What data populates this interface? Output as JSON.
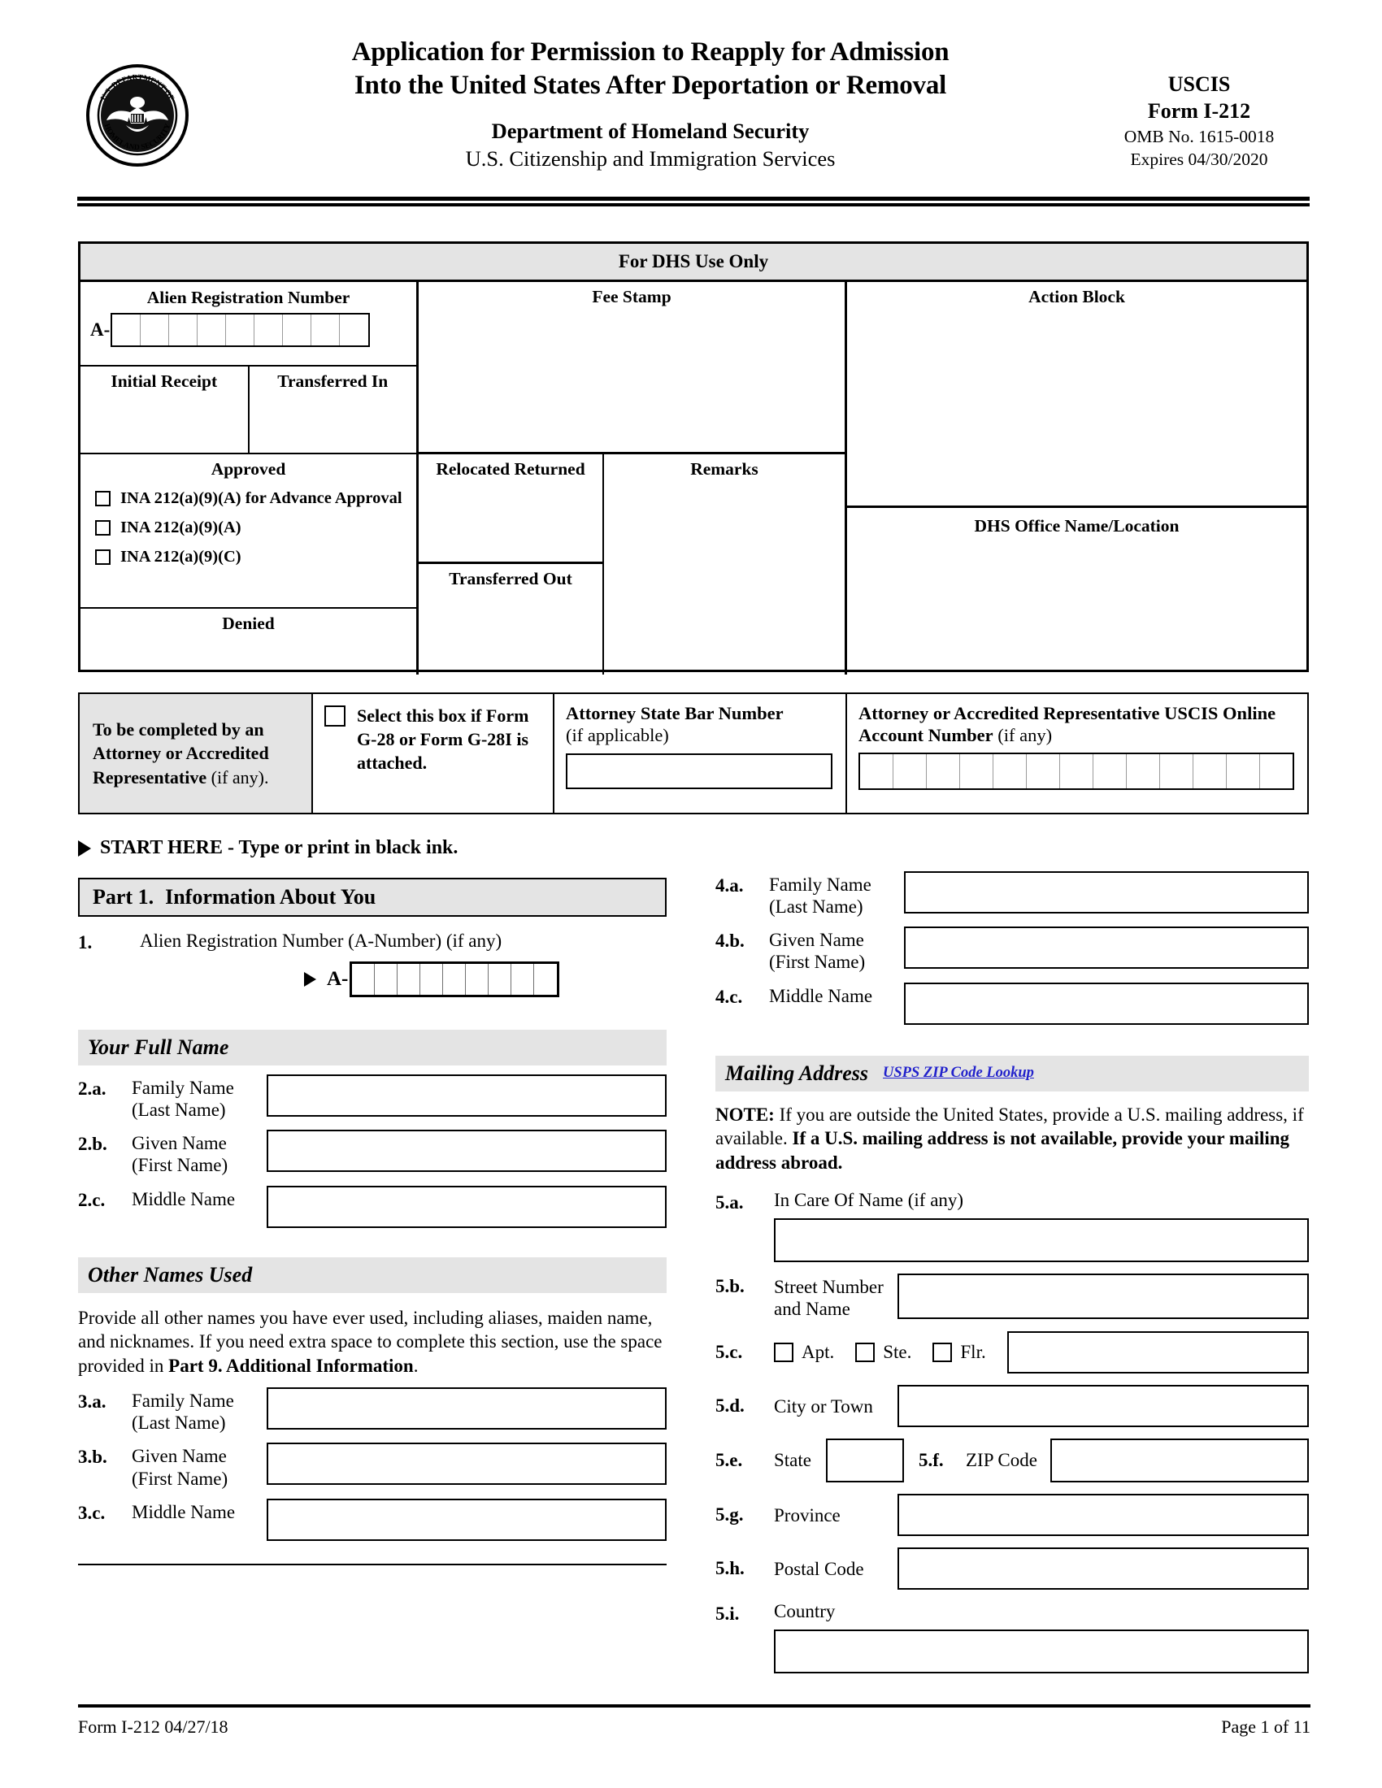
{
  "header": {
    "title_line1": "Application for Permission to Reapply for Admission",
    "title_line2": "Into the United States After Deportation or Removal",
    "department": "Department of Homeland Security",
    "agency": "U.S. Citizenship and Immigration Services",
    "seal_alt": "dhs-seal",
    "uscis": "USCIS",
    "form_number": "Form I-212",
    "omb": "OMB No. 1615-0018",
    "expires": "Expires 04/30/2020"
  },
  "dhs_block": {
    "title": "For DHS Use Only",
    "alien_registration_number_label": "Alien Registration Number",
    "a_prefix": "A-",
    "a_number_cells": 9,
    "initial_receipt": "Initial Receipt",
    "transferred_in": "Transferred In",
    "approved": "Approved",
    "approved_options": [
      "INA 212(a)(9)(A) for Advance Approval",
      "INA 212(a)(9)(A)",
      "INA 212(a)(9)(C)"
    ],
    "denied": "Denied",
    "fee_stamp": "Fee Stamp",
    "relocated_returned": "Relocated Returned",
    "transferred_out": "Transferred Out",
    "remarks": "Remarks",
    "action_block": "Action Block",
    "dhs_office": "DHS Office Name/Location"
  },
  "attorney": {
    "heading_bold": "To be completed by an Attorney or Accredited Representative",
    "heading_reg": " (if any).",
    "g28_checkbox_label": "Select this box if Form G-28 or Form G-28I is attached.",
    "bar_number_label": "Attorney State Bar Number",
    "bar_number_sub": "(if applicable)",
    "online_account_bold": "Attorney or Accredited Representative USCIS Online Account Number",
    "online_account_reg": " (if any)",
    "online_account_cells": 13
  },
  "start_here": "START HERE - Type or print in black ink.",
  "part1": {
    "number": "Part 1.",
    "title": "Information About You",
    "q1_num": "1.",
    "q1_text": "Alien Registration Number (A-Number) (if any)",
    "a_prefix": "A-",
    "a_number_cells": 9,
    "your_full_name_heading": "Your Full Name",
    "name_fields": [
      {
        "num": "2.a.",
        "l1": "Family Name",
        "l2": "(Last Name)"
      },
      {
        "num": "2.b.",
        "l1": "Given Name",
        "l2": "(First Name)"
      },
      {
        "num": "2.c.",
        "l1": "Middle Name",
        "l2": ""
      }
    ],
    "other_names_heading": "Other Names Used",
    "other_names_para_a": "Provide all other names you have ever used, including aliases, maiden name, and nicknames. If you need extra space to complete this section, use the space provided in ",
    "other_names_para_b": "Part 9. Additional Information",
    "other_names_para_c": ".",
    "other_name_fields": [
      {
        "num": "3.a.",
        "l1": "Family Name",
        "l2": "(Last Name)"
      },
      {
        "num": "3.b.",
        "l1": "Given Name",
        "l2": "(First Name)"
      },
      {
        "num": "3.c.",
        "l1": "Middle Name",
        "l2": ""
      }
    ],
    "right_name_fields": [
      {
        "num": "4.a.",
        "l1": "Family Name",
        "l2": "(Last Name)"
      },
      {
        "num": "4.b.",
        "l1": "Given Name",
        "l2": "(First Name)"
      },
      {
        "num": "4.c.",
        "l1": "Middle Name",
        "l2": ""
      }
    ],
    "mailing_address_heading": "Mailing Address",
    "usps_link": "USPS ZIP Code Lookup",
    "note_bold_1": "NOTE:",
    "note_reg_1": " If you are outside the United States, provide a U.S. mailing address, if available.  ",
    "note_bold_2": "If a U.S. mailing address is not available, provide your mailing address abroad.",
    "addr_5a_num": "5.a.",
    "addr_5a_label": "In Care Of Name (if any)",
    "addr_5b_num": "5.b.",
    "addr_5b_l1": "Street Number",
    "addr_5b_l2": "and Name",
    "addr_5c_num": "5.c.",
    "addr_5c_apt": "Apt.",
    "addr_5c_ste": "Ste.",
    "addr_5c_flr": "Flr.",
    "addr_5d_num": "5.d.",
    "addr_5d_label": "City or Town",
    "addr_5e_num": "5.e.",
    "addr_5e_label": "State",
    "addr_5f_num": "5.f.",
    "addr_5f_label": "ZIP Code",
    "addr_5g_num": "5.g.",
    "addr_5g_label": "Province",
    "addr_5h_num": "5.h.",
    "addr_5h_label": "Postal Code",
    "addr_5i_num": "5.i.",
    "addr_5i_label": "Country"
  },
  "footer": {
    "left": "Form I-212   04/27/18",
    "right": "Page 1 of 11"
  },
  "colors": {
    "shade": "#e4e4e4",
    "link": "#2222cc",
    "rule": "#000000"
  }
}
